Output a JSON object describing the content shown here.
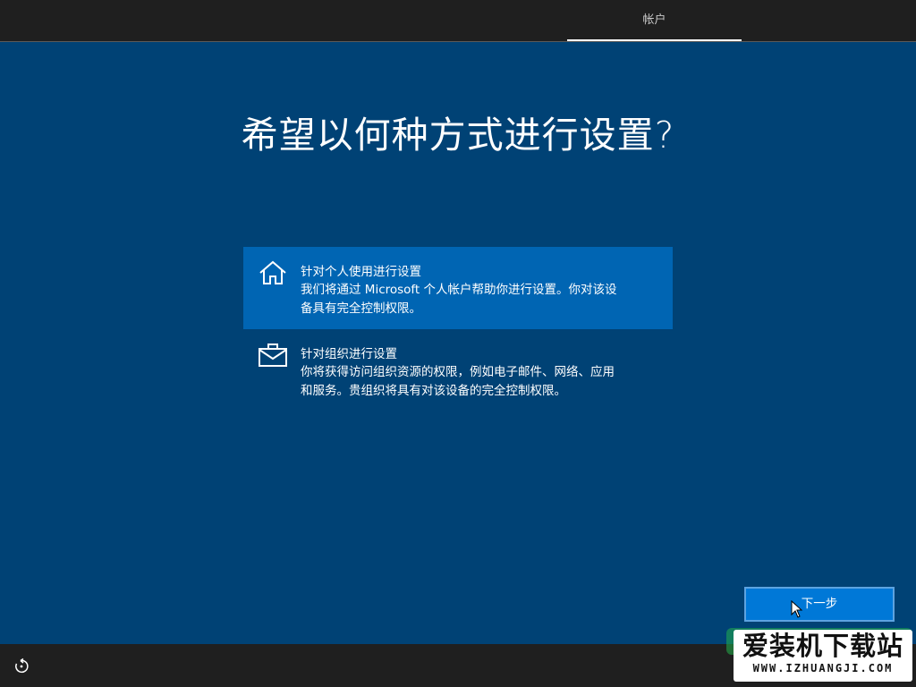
{
  "topbar": {
    "tab_label": "帐户"
  },
  "main": {
    "title": "希望以何种方式进行设置?",
    "options": [
      {
        "icon": "home-icon",
        "title": "针对个人使用进行设置",
        "desc_line1": "我们将通过 Microsoft 个人帐户帮助你进行设置。你对该设",
        "desc_line2": "备具有完全控制权限。",
        "selected": true
      },
      {
        "icon": "briefcase-icon",
        "title": "针对组织进行设置",
        "desc_line1": "你将获得访问组织资源的权限，例如电子邮件、网络、应用",
        "desc_line2": "和服务。贵组织将具有对该设备的完全控制权限。",
        "selected": false
      }
    ]
  },
  "footer": {
    "next_label": "下一步",
    "accessibility_icon": "ease-of-access-icon"
  },
  "watermark": {
    "main": "爱装机下载站",
    "url": "WWW.IZHUANGJI.COM"
  },
  "colors": {
    "background": "#004275",
    "selected": "#0065b3",
    "button": "#0078d7",
    "bar": "#1f1f1f"
  }
}
